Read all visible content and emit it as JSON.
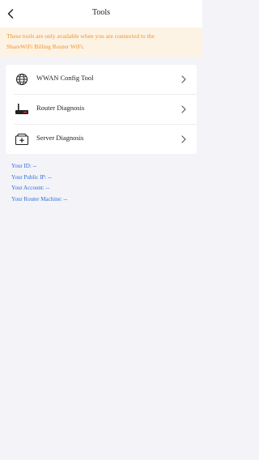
{
  "header": {
    "title": "Tools",
    "back_icon": "chevron-left-icon"
  },
  "notice": {
    "line1": "These tools are only available when you are connected to the",
    "line2": "ShareWiFi Billing Router WiFi.",
    "color": "#f0932b"
  },
  "menu": {
    "items": [
      {
        "label": "WWAN Config Tool",
        "icon": "globe-icon"
      },
      {
        "label": "Router Diagnosis",
        "icon": "router-icon"
      },
      {
        "label": "Server Diagnosis",
        "icon": "server-medical-icon"
      }
    ]
  },
  "info": {
    "your_id": "Your ID: --",
    "public_ip": "Your Public IP: --",
    "account": "Your Account: --",
    "router_machine": "Your Router Machine: --",
    "color": "#2f6fd9"
  }
}
